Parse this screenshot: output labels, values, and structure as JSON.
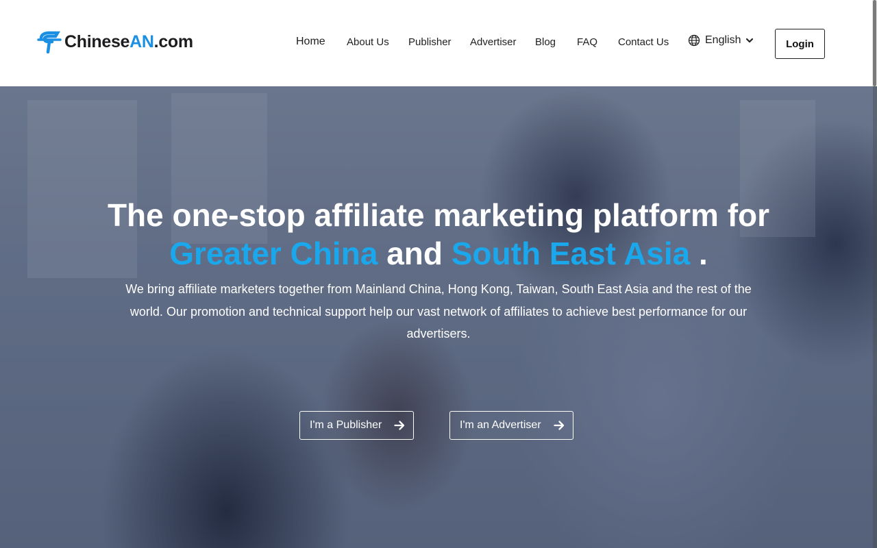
{
  "brand": {
    "name_part1": "Chinese",
    "name_part2": "AN",
    "name_part3": ".com",
    "accent_color": "#1a8fe3"
  },
  "nav": {
    "items": [
      {
        "label": "Home"
      },
      {
        "label": "About Us"
      },
      {
        "label": "Publisher"
      },
      {
        "label": "Advertiser"
      },
      {
        "label": "Blog"
      },
      {
        "label": "FAQ"
      },
      {
        "label": "Contact Us"
      }
    ],
    "language": {
      "label": "English",
      "icon": "globe-icon",
      "chevron": "chevron-down-icon"
    },
    "login_label": "Login"
  },
  "hero": {
    "title_line1": "The one-stop affiliate marketing platform for",
    "title_hl1": "Greater China",
    "title_mid": "and",
    "title_hl2": "South East Asia",
    "title_end": ".",
    "highlight_color": "#1aa7ec",
    "subtitle": "We bring affiliate marketers together from Mainland China, Hong Kong, Taiwan, South East Asia and the rest of the world. Our promotion and technical support help our vast network of affiliates to achieve best performance for our advertisers.",
    "cta_publisher": "I'm a Publisher",
    "cta_advertiser": "I'm an Advertiser",
    "cta_icon": "arrow-right-icon"
  }
}
